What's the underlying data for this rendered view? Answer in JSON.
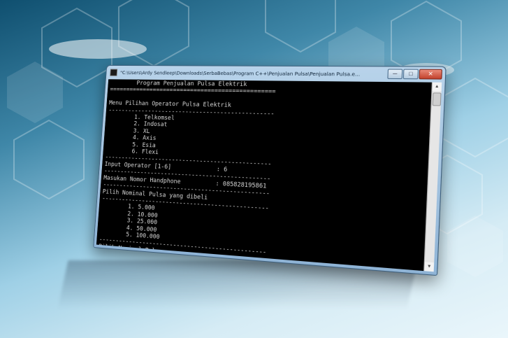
{
  "window": {
    "title": "\"C:\\Users\\Ardy Sendleep\\Downloads\\SerbaBebas\\Program C++\\Penjualan Pulsa\\Penjualan Pulsa.e...",
    "minimize_glyph": "─",
    "maximize_glyph": "□",
    "close_glyph": "✕"
  },
  "console": {
    "lines": [
      "        Program Penjualan Pulsa Elektrik",
      "================================================",
      "",
      "Menu Pilihan Operator Pulsa Elektrik",
      "------------------------------------------------",
      "        1. Telkomsel",
      "        2. Indosat",
      "        3. XL",
      "        4. Axis",
      "        5. Esia",
      "        6. Flexi",
      "------------------------------------------------",
      "Input Operator [1-6]             : 6",
      "------------------------------------------------",
      "Masukan Nomor Handphone          : 085828195861",
      "------------------------------------------------",
      "Pilih Nominal Pulsa yang dibeli",
      "------------------------------------------------",
      "        1. 5.000",
      "        2. 10.000",
      "        3. 25.000",
      "        4. 50.000",
      "        5. 100.000",
      "------------------------------------------------",
      "Pilih Nominal Pulsa",
      "                                 : _"
    ]
  }
}
